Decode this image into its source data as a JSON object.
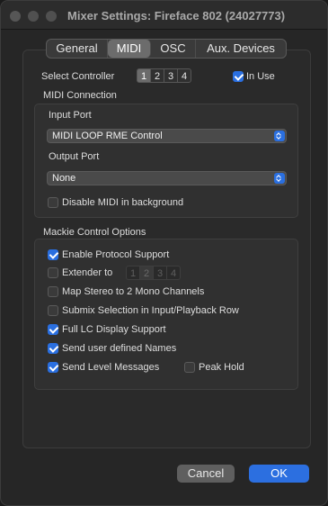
{
  "window": {
    "title": "Mixer Settings: Fireface 802 (24027773)"
  },
  "tabs": [
    {
      "label": "General",
      "selected": false
    },
    {
      "label": "MIDI",
      "selected": true
    },
    {
      "label": "OSC",
      "selected": false
    },
    {
      "label": "Aux. Devices",
      "selected": false
    }
  ],
  "controller": {
    "label": "Select Controller",
    "options": [
      "1",
      "2",
      "3",
      "4"
    ],
    "selected": "1",
    "in_use_label": "In Use",
    "in_use_checked": true
  },
  "midi_connection": {
    "heading": "MIDI Connection",
    "input_port_label": "Input Port",
    "input_port_value": "MIDI LOOP RME Control",
    "output_port_label": "Output Port",
    "output_port_value": "None",
    "disable_bg_label": "Disable MIDI in background",
    "disable_bg_checked": false
  },
  "mackie": {
    "heading": "Mackie Control Options",
    "enable_protocol_label": "Enable Protocol Support",
    "enable_protocol_checked": true,
    "extender_label": "Extender to",
    "extender_checked": false,
    "extender_options": [
      "1",
      "2",
      "3",
      "4"
    ],
    "extender_selected": "2",
    "map_stereo_label": "Map Stereo to 2 Mono Channels",
    "map_stereo_checked": false,
    "submix_label": "Submix Selection in Input/Playback Row",
    "submix_checked": false,
    "full_lc_label": "Full LC Display Support",
    "full_lc_checked": true,
    "send_names_label": "Send user defined Names",
    "send_names_checked": true,
    "send_level_label": "Send Level Messages",
    "send_level_checked": true,
    "peak_hold_label": "Peak Hold",
    "peak_hold_checked": false
  },
  "buttons": {
    "cancel": "Cancel",
    "ok": "OK"
  },
  "colors": {
    "accent": "#2c6fe0",
    "window_bg": "#262626"
  }
}
